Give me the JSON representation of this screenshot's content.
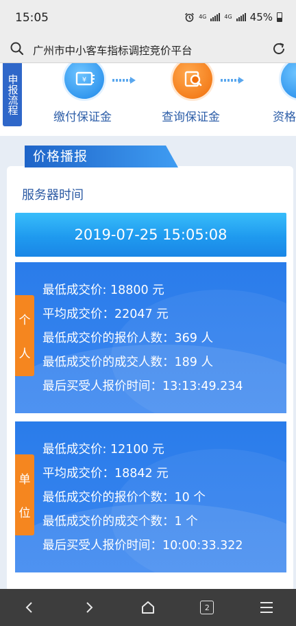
{
  "status_bar": {
    "time": "15:05",
    "net": "4G",
    "battery": "45%"
  },
  "browser": {
    "page_title": "广州市中小客车指标调控竞价平台",
    "tab_count": "2"
  },
  "process": {
    "tag": "申报流程",
    "steps": [
      {
        "label": "缴付保证金",
        "icon": "payment-icon"
      },
      {
        "label": "查询保证金",
        "icon": "search-document-icon"
      },
      {
        "label": "资格",
        "icon": "qualification-icon"
      }
    ]
  },
  "price_broadcast": {
    "title": "价格播报",
    "server_time_label": "服务器时间",
    "server_time": "2019-07-25 15:05:08",
    "individual": {
      "tab_chars": [
        "个",
        "人"
      ],
      "lines": [
        "最低成交价: 18800 元",
        "平均成交价：22047 元",
        "最低成交价的报价人数：369 人",
        "最低成交价的成交人数：189 人",
        "最后买受人报价时间：13:13:49.234"
      ]
    },
    "company": {
      "tab_chars": [
        "单",
        "位"
      ],
      "lines": [
        "最低成交价: 12100 元",
        "平均成交价：18842 元",
        "最低成交价的报价个数：10 个",
        "最低成交价的成交个数：1 个",
        "最后买受人报价时间：10:00:33.322"
      ]
    }
  },
  "colors": {
    "primary": "#2a7cea",
    "accent": "#f5861f",
    "title": "#2a59a3"
  }
}
